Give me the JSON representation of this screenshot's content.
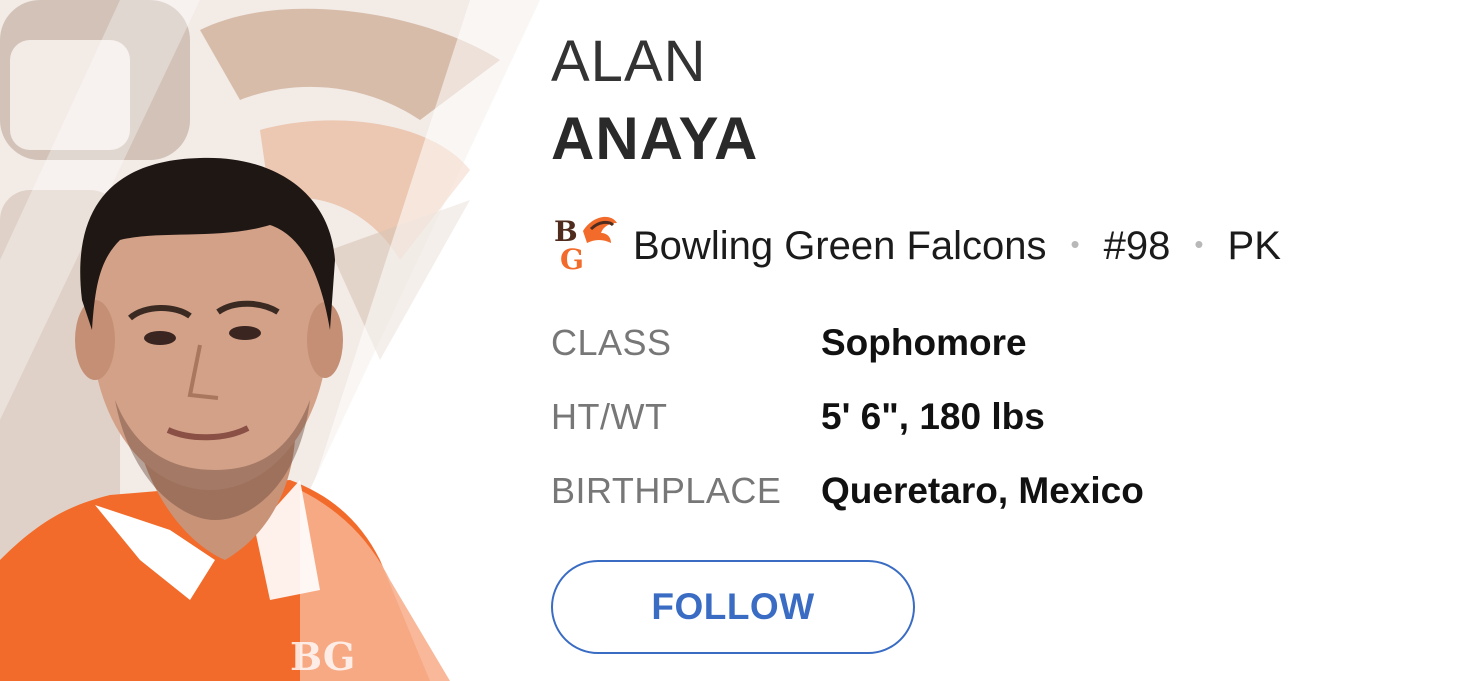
{
  "player": {
    "first_name": "ALAN",
    "last_name": "ANAYA",
    "photo_icon": "player-headshot",
    "team": {
      "logo_icon": "bowling-green-logo-icon",
      "name": "Bowling Green Falcons",
      "separator": "•",
      "number": "#98",
      "position": "PK"
    },
    "details": [
      {
        "label": "CLASS",
        "value": "Sophomore"
      },
      {
        "label": "HT/WT",
        "value": "5' 6\", 180 lbs"
      },
      {
        "label": "BIRTHPLACE",
        "value": "Queretaro, Mexico"
      }
    ],
    "follow_label": "FOLLOW"
  },
  "colors": {
    "accent": "#3a6cc4",
    "team_orange": "#f26b2a",
    "team_brown": "#4f2c1d",
    "label_gray": "#777777"
  }
}
